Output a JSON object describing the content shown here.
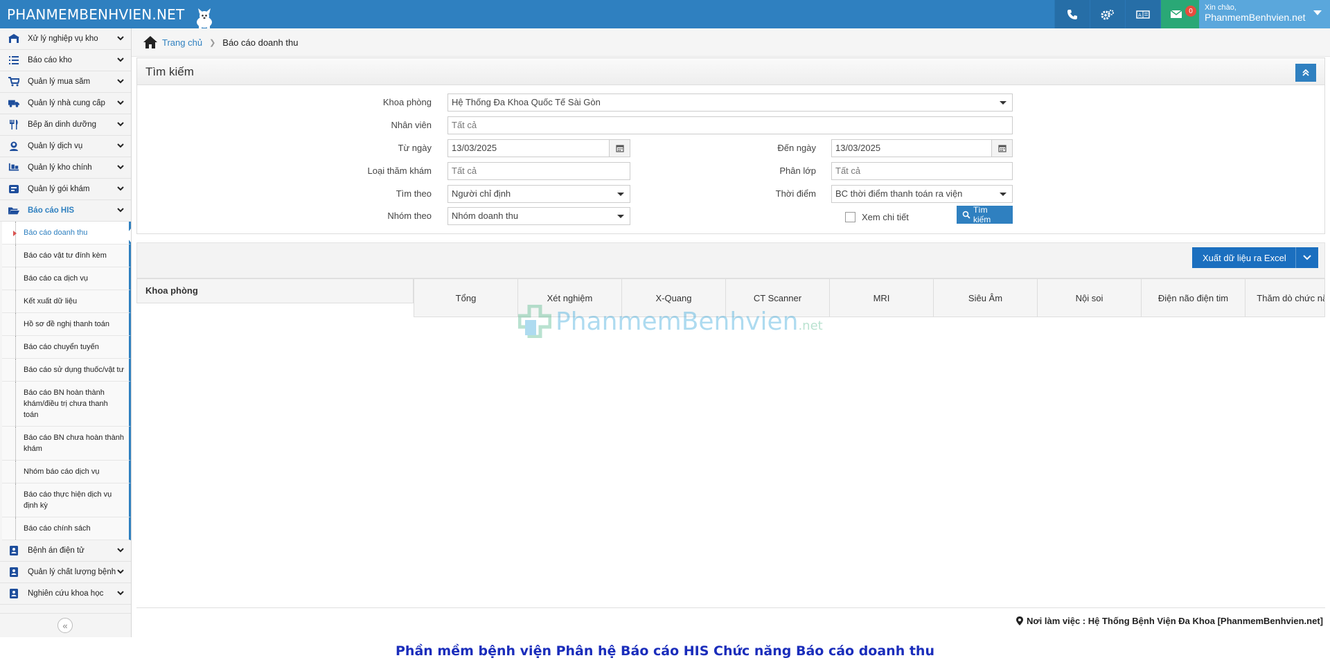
{
  "topbar": {
    "brand": "PHANMEMBENHVIEN.NET",
    "mail_count": "0",
    "greeting": "Xin chào,",
    "username": "PhanmemBenhvien.net"
  },
  "sidebar": {
    "items": [
      {
        "label": "Xử lý nghiệp vụ kho",
        "icon": "warehouse-icon"
      },
      {
        "label": "Báo cáo kho",
        "icon": "list-icon"
      },
      {
        "label": "Quản lý mua sắm",
        "icon": "cart-icon"
      },
      {
        "label": "Quản lý nhà cung cấp",
        "icon": "truck-icon"
      },
      {
        "label": "Bếp ăn dinh dưỡng",
        "icon": "cutlery-icon"
      },
      {
        "label": "Quản lý dịch vụ",
        "icon": "user-icon"
      },
      {
        "label": "Quản lý kho chính",
        "icon": "dolly-icon"
      },
      {
        "label": "Quản lý gói khám",
        "icon": "box-icon"
      },
      {
        "label": "Báo cáo HIS",
        "icon": "folder-open-icon"
      }
    ],
    "sub_items": [
      "Báo cáo doanh thu",
      "Báo cáo vật tư đính kèm",
      "Báo cáo ca dịch vụ",
      "Kết xuất dữ liệu",
      "Hồ sơ đề nghị thanh toán",
      "Báo cáo chuyển tuyến",
      "Báo cáo sử dụng thuốc/vật tư",
      "Báo cáo BN hoàn thành khám/điều trị chưa thanh toán",
      "Báo cáo BN chưa hoàn thành khám",
      "Nhóm báo cáo dịch vụ",
      "Báo cáo thực hiện dịch vụ định kỳ",
      "Báo cáo chính sách"
    ],
    "bottom_items": [
      {
        "label": "Bệnh án điện tử",
        "icon": "id-card-icon"
      },
      {
        "label": "Quản lý chất lượng bệnh viện",
        "icon": "id-card-icon"
      },
      {
        "label": "Nghiên cứu khoa học",
        "icon": "id-card-icon"
      }
    ],
    "collapse_glyph": "«"
  },
  "breadcrumb": {
    "home": "Trang chủ",
    "current": "Báo cáo doanh thu"
  },
  "search_panel": {
    "title": "Tìm kiếm",
    "khoa_phong_label": "Khoa phòng",
    "khoa_phong_value": "Hệ Thống Đa Khoa Quốc Tế Sài Gòn",
    "nhan_vien_label": "Nhân viên",
    "nhan_vien_placeholder": "Tất cả",
    "tu_ngay_label": "Từ ngày",
    "tu_ngay_value": "13/03/2025",
    "den_ngay_label": "Đến ngày",
    "den_ngay_value": "13/03/2025",
    "loai_tham_kham_label": "Loại thăm khám",
    "loai_tham_kham_placeholder": "Tất cả",
    "phan_lop_label": "Phân lớp",
    "phan_lop_placeholder": "Tất cả",
    "tim_theo_label": "Tìm theo",
    "tim_theo_value": "Người chỉ định",
    "thoi_diem_label": "Thời điểm",
    "thoi_diem_value": "BC thời điểm thanh toán ra viện",
    "nhom_theo_label": "Nhóm theo",
    "nhom_theo_value": "Nhóm doanh thu",
    "xem_chi_tiet_label": "Xem chi tiết",
    "search_button": "Tìm kiếm"
  },
  "results": {
    "export_button": "Xuất dữ liệu ra Excel",
    "left_header": "Khoa phòng",
    "columns": [
      "Tổng",
      "Xét nghiệm",
      "X-Quang",
      "CT Scanner",
      "MRI",
      "Siêu Âm",
      "Nội soi",
      "Điện não điện tim",
      "Thăm dò chức năng"
    ]
  },
  "watermark": {
    "main": "PhanmemBenhvien",
    "suffix": ".net"
  },
  "footer": {
    "workplace": "Nơi làm việc : Hệ Thống Bệnh Viện Đa Khoa [PhanmemBenhvien.net]"
  },
  "caption": "Phần mềm bệnh viện Phân hệ Báo cáo HIS Chức năng Báo cáo doanh thu",
  "colors": {
    "primary": "#2f80c0",
    "mail": "#2aa876",
    "caption": "#1a2dbb"
  }
}
